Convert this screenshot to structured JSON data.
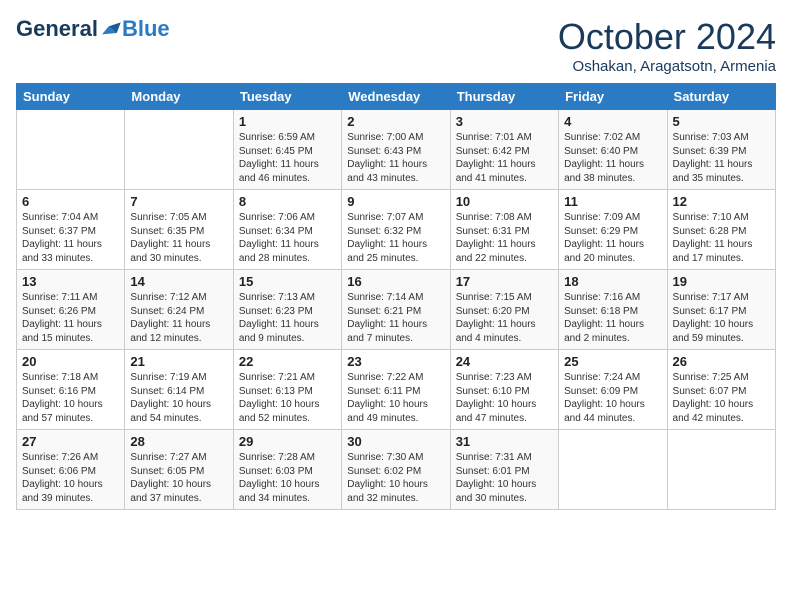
{
  "header": {
    "logo_general": "General",
    "logo_blue": "Blue",
    "month": "October 2024",
    "location": "Oshakan, Aragatsotn, Armenia"
  },
  "days_of_week": [
    "Sunday",
    "Monday",
    "Tuesday",
    "Wednesday",
    "Thursday",
    "Friday",
    "Saturday"
  ],
  "weeks": [
    [
      {
        "day": "",
        "info": ""
      },
      {
        "day": "",
        "info": ""
      },
      {
        "day": "1",
        "info": "Sunrise: 6:59 AM\nSunset: 6:45 PM\nDaylight: 11 hours and 46 minutes."
      },
      {
        "day": "2",
        "info": "Sunrise: 7:00 AM\nSunset: 6:43 PM\nDaylight: 11 hours and 43 minutes."
      },
      {
        "day": "3",
        "info": "Sunrise: 7:01 AM\nSunset: 6:42 PM\nDaylight: 11 hours and 41 minutes."
      },
      {
        "day": "4",
        "info": "Sunrise: 7:02 AM\nSunset: 6:40 PM\nDaylight: 11 hours and 38 minutes."
      },
      {
        "day": "5",
        "info": "Sunrise: 7:03 AM\nSunset: 6:39 PM\nDaylight: 11 hours and 35 minutes."
      }
    ],
    [
      {
        "day": "6",
        "info": "Sunrise: 7:04 AM\nSunset: 6:37 PM\nDaylight: 11 hours and 33 minutes."
      },
      {
        "day": "7",
        "info": "Sunrise: 7:05 AM\nSunset: 6:35 PM\nDaylight: 11 hours and 30 minutes."
      },
      {
        "day": "8",
        "info": "Sunrise: 7:06 AM\nSunset: 6:34 PM\nDaylight: 11 hours and 28 minutes."
      },
      {
        "day": "9",
        "info": "Sunrise: 7:07 AM\nSunset: 6:32 PM\nDaylight: 11 hours and 25 minutes."
      },
      {
        "day": "10",
        "info": "Sunrise: 7:08 AM\nSunset: 6:31 PM\nDaylight: 11 hours and 22 minutes."
      },
      {
        "day": "11",
        "info": "Sunrise: 7:09 AM\nSunset: 6:29 PM\nDaylight: 11 hours and 20 minutes."
      },
      {
        "day": "12",
        "info": "Sunrise: 7:10 AM\nSunset: 6:28 PM\nDaylight: 11 hours and 17 minutes."
      }
    ],
    [
      {
        "day": "13",
        "info": "Sunrise: 7:11 AM\nSunset: 6:26 PM\nDaylight: 11 hours and 15 minutes."
      },
      {
        "day": "14",
        "info": "Sunrise: 7:12 AM\nSunset: 6:24 PM\nDaylight: 11 hours and 12 minutes."
      },
      {
        "day": "15",
        "info": "Sunrise: 7:13 AM\nSunset: 6:23 PM\nDaylight: 11 hours and 9 minutes."
      },
      {
        "day": "16",
        "info": "Sunrise: 7:14 AM\nSunset: 6:21 PM\nDaylight: 11 hours and 7 minutes."
      },
      {
        "day": "17",
        "info": "Sunrise: 7:15 AM\nSunset: 6:20 PM\nDaylight: 11 hours and 4 minutes."
      },
      {
        "day": "18",
        "info": "Sunrise: 7:16 AM\nSunset: 6:18 PM\nDaylight: 11 hours and 2 minutes."
      },
      {
        "day": "19",
        "info": "Sunrise: 7:17 AM\nSunset: 6:17 PM\nDaylight: 10 hours and 59 minutes."
      }
    ],
    [
      {
        "day": "20",
        "info": "Sunrise: 7:18 AM\nSunset: 6:16 PM\nDaylight: 10 hours and 57 minutes."
      },
      {
        "day": "21",
        "info": "Sunrise: 7:19 AM\nSunset: 6:14 PM\nDaylight: 10 hours and 54 minutes."
      },
      {
        "day": "22",
        "info": "Sunrise: 7:21 AM\nSunset: 6:13 PM\nDaylight: 10 hours and 52 minutes."
      },
      {
        "day": "23",
        "info": "Sunrise: 7:22 AM\nSunset: 6:11 PM\nDaylight: 10 hours and 49 minutes."
      },
      {
        "day": "24",
        "info": "Sunrise: 7:23 AM\nSunset: 6:10 PM\nDaylight: 10 hours and 47 minutes."
      },
      {
        "day": "25",
        "info": "Sunrise: 7:24 AM\nSunset: 6:09 PM\nDaylight: 10 hours and 44 minutes."
      },
      {
        "day": "26",
        "info": "Sunrise: 7:25 AM\nSunset: 6:07 PM\nDaylight: 10 hours and 42 minutes."
      }
    ],
    [
      {
        "day": "27",
        "info": "Sunrise: 7:26 AM\nSunset: 6:06 PM\nDaylight: 10 hours and 39 minutes."
      },
      {
        "day": "28",
        "info": "Sunrise: 7:27 AM\nSunset: 6:05 PM\nDaylight: 10 hours and 37 minutes."
      },
      {
        "day": "29",
        "info": "Sunrise: 7:28 AM\nSunset: 6:03 PM\nDaylight: 10 hours and 34 minutes."
      },
      {
        "day": "30",
        "info": "Sunrise: 7:30 AM\nSunset: 6:02 PM\nDaylight: 10 hours and 32 minutes."
      },
      {
        "day": "31",
        "info": "Sunrise: 7:31 AM\nSunset: 6:01 PM\nDaylight: 10 hours and 30 minutes."
      },
      {
        "day": "",
        "info": ""
      },
      {
        "day": "",
        "info": ""
      }
    ]
  ]
}
